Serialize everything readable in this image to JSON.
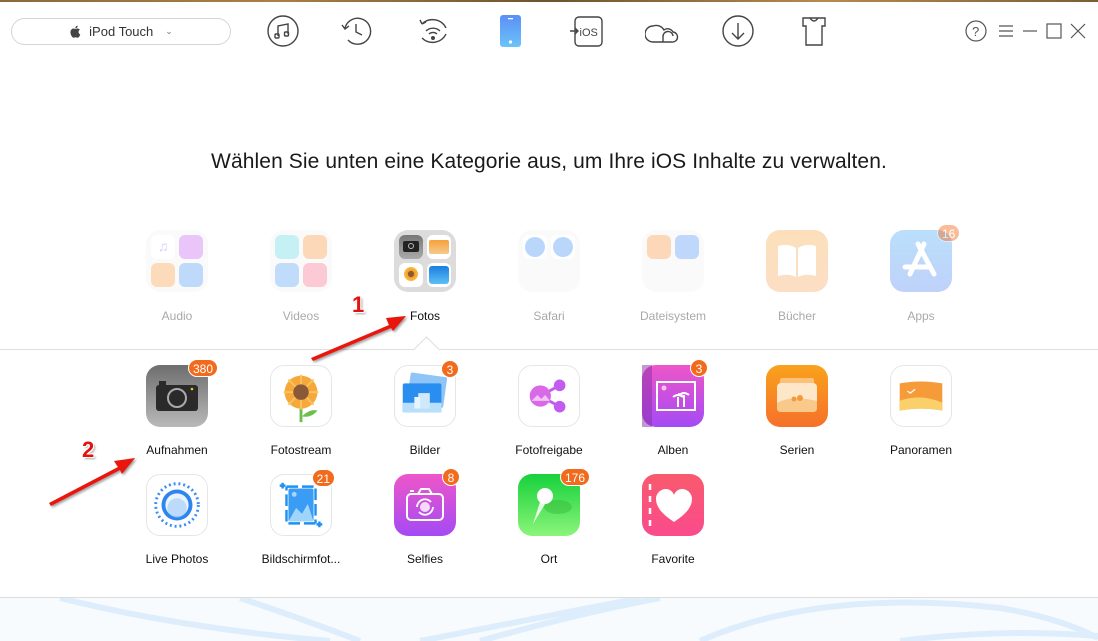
{
  "toolbar": {
    "device_name": "iPod Touch",
    "icons": [
      {
        "name": "music-icon",
        "label": "Audio Manager"
      },
      {
        "name": "history-backup-icon",
        "label": "Backup"
      },
      {
        "name": "wifi-sync-icon",
        "label": "Wi-Fi"
      },
      {
        "name": "device-icon",
        "label": "Device",
        "active": true
      },
      {
        "name": "ios-mover-icon",
        "label": "iOS Mover",
        "text": "iOS"
      },
      {
        "name": "cloud-icon",
        "label": "iCloud"
      },
      {
        "name": "download-icon",
        "label": "Download"
      },
      {
        "name": "tshirt-icon",
        "label": "Skin"
      }
    ],
    "window_controls": [
      "help-icon",
      "menu-icon",
      "minimize-icon",
      "maximize-icon",
      "close-icon"
    ],
    "active_color": "#5b9bf5"
  },
  "heading": "Wählen Sie unten eine Kategorie aus, um Ihre iOS Inhalte zu verwalten.",
  "categories": [
    {
      "id": "audio",
      "label": "Audio",
      "active": false
    },
    {
      "id": "videos",
      "label": "Videos",
      "active": false
    },
    {
      "id": "fotos",
      "label": "Fotos",
      "active": true
    },
    {
      "id": "safari",
      "label": "Safari",
      "active": false
    },
    {
      "id": "dateisystem",
      "label": "Dateisystem",
      "active": false
    },
    {
      "id": "buecher",
      "label": "Bücher",
      "active": false
    },
    {
      "id": "apps",
      "label": "Apps",
      "active": false,
      "badge": "16"
    }
  ],
  "subcategories": [
    {
      "id": "aufnahmen",
      "label": "Aufnahmen",
      "badge": "380"
    },
    {
      "id": "fotostream",
      "label": "Fotostream"
    },
    {
      "id": "bilder",
      "label": "Bilder",
      "badge": "3"
    },
    {
      "id": "fotofreigabe",
      "label": "Fotofreigabe"
    },
    {
      "id": "alben",
      "label": "Alben",
      "badge": "3"
    },
    {
      "id": "serien",
      "label": "Serien"
    },
    {
      "id": "panoramen",
      "label": "Panoramen"
    },
    {
      "id": "livephotos",
      "label": "Live Photos"
    },
    {
      "id": "bildschirmfotos",
      "label": "Bildschirmfot...",
      "badge": "21"
    },
    {
      "id": "selfies",
      "label": "Selfies",
      "badge": "8"
    },
    {
      "id": "ort",
      "label": "Ort",
      "badge": "176"
    },
    {
      "id": "favorite",
      "label": "Favorite"
    }
  ],
  "annotations": [
    {
      "number": "1",
      "target": "Fotos"
    },
    {
      "number": "2",
      "target": "Aufnahmen"
    }
  ],
  "colors": {
    "badge": "#f26b1d",
    "annotation": "#e3110f"
  }
}
